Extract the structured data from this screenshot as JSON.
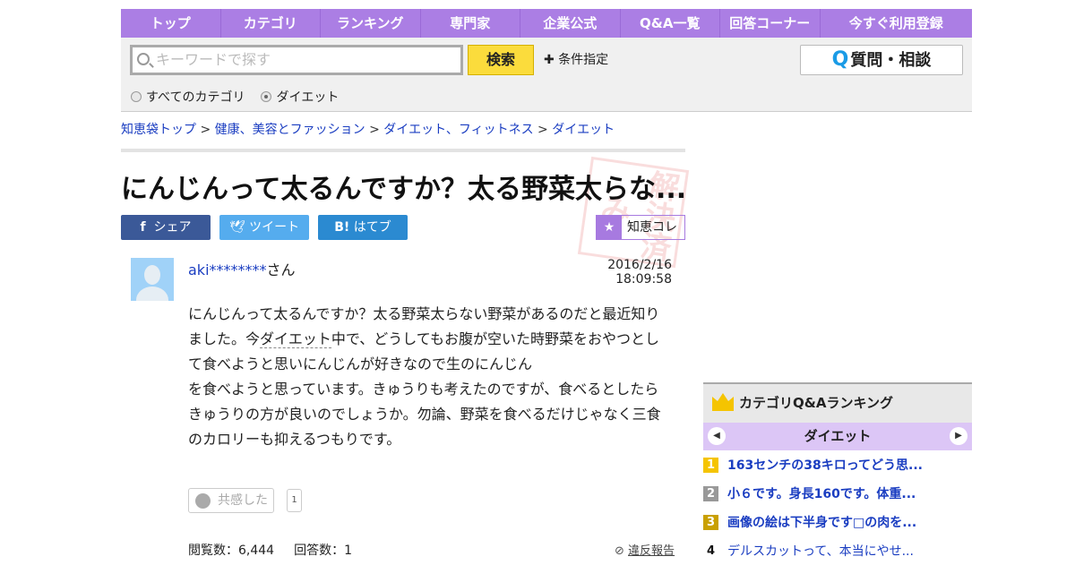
{
  "nav": [
    "トップ",
    "カテゴリ",
    "ランキング",
    "専門家",
    "企業公式",
    "Q&A一覧",
    "回答コーナー",
    "今すぐ利用登録"
  ],
  "search": {
    "placeholder": "キーワードで探す",
    "button": "検索",
    "conditions": "条件指定",
    "ask": "質問・相談",
    "ask_icon": "Q",
    "scopes": [
      "すべてのカテゴリ",
      "ダイエット"
    ]
  },
  "breadcrumb": [
    "知恵袋トップ",
    "健康、美容とファッション",
    "ダイエット、フィットネス",
    "ダイエット"
  ],
  "question": {
    "title": "にんじんって太るんですか？太る野菜太らな...",
    "stamp": "解決済み",
    "share": {
      "facebook": "シェア",
      "twitter": "ツイート",
      "hatena": "はてブ",
      "hatena_icon": "B!"
    },
    "chiecole": "知恵コレ",
    "user": "aki********",
    "user_suffix": "さん",
    "date": "2016/2/16  18:09:58",
    "body_1": "にんじんって太るんですか？太る野菜太らない野菜があるのだと最近知りました。今",
    "body_link": "ダイエット",
    "body_2": "中で、どうしてもお腹が空いた時野菜をおやつとして食べようと思いにんじんが好きなので生のにんじん",
    "body_3": "を食べようと思っています。きゅうりも考えたのですが、食べるとしたらきゅうりの方が良いのでしょうか。勿論、野菜を食べるだけじゃなく三食のカロリーも抑えるつもりです。",
    "empathy": "共感した",
    "empathy_count": "1",
    "views": "閲覧数：6,444",
    "answers": "回答数：1",
    "report": "違反報告"
  },
  "ranking": {
    "title": "カテゴリQ&Aランキング",
    "category": "ダイエット",
    "items": [
      {
        "rank": "1",
        "text": "163センチの38キロってどう思...",
        "color": "#f5c400"
      },
      {
        "rank": "2",
        "text": "小６です。身長160です。体重...",
        "color": "#999999"
      },
      {
        "rank": "3",
        "text": "画像の絵は下半身です□の肉を...",
        "color": "#c9a000"
      },
      {
        "rank": "4",
        "text": "デルスカットって、本当にやせ...",
        "color": "#ffffff"
      }
    ]
  }
}
